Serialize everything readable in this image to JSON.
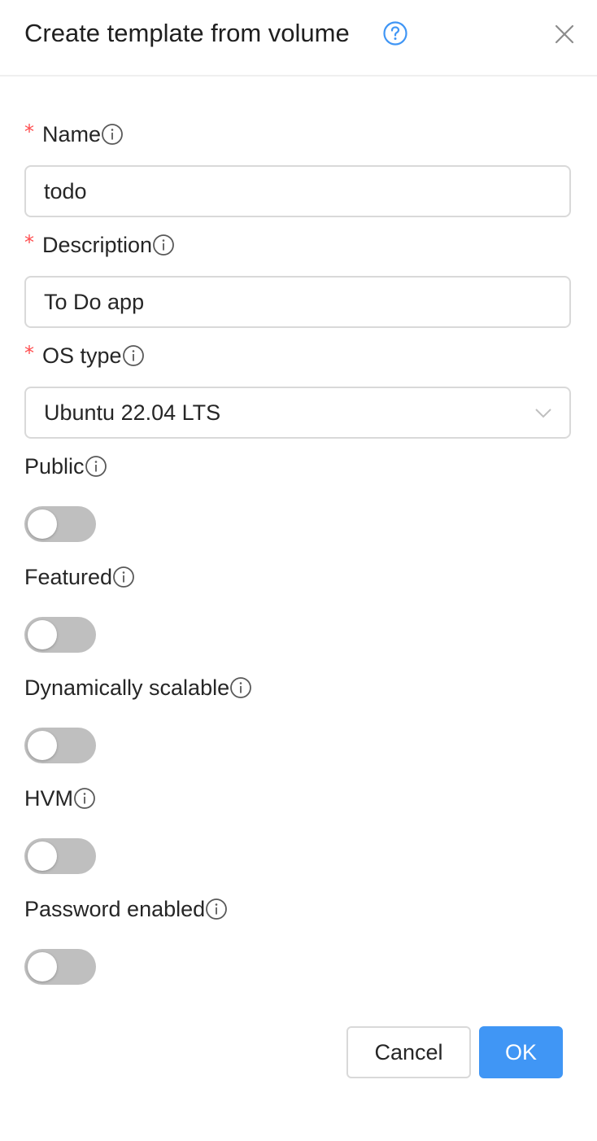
{
  "dialog": {
    "title": "Create template from volume",
    "help_icon": "question-circle-icon",
    "close_icon": "close-icon"
  },
  "form": {
    "name": {
      "label": "Name",
      "required": true,
      "value": "todo"
    },
    "description": {
      "label": "Description",
      "required": true,
      "value": "To Do app"
    },
    "os_type": {
      "label": "OS type",
      "required": true,
      "selected": "Ubuntu 22.04 LTS"
    },
    "public": {
      "label": "Public",
      "enabled": false
    },
    "featured": {
      "label": "Featured",
      "enabled": false
    },
    "dynamically_scalable": {
      "label": "Dynamically scalable",
      "enabled": false
    },
    "hvm": {
      "label": "HVM",
      "enabled": false
    },
    "password_enabled": {
      "label": "Password enabled",
      "enabled": false
    }
  },
  "footer": {
    "cancel_label": "Cancel",
    "ok_label": "OK"
  },
  "colors": {
    "primary": "#4096f5",
    "required": "#ff4d4f",
    "switch_off": "#bfbfbf",
    "border": "#d9d9d9"
  }
}
